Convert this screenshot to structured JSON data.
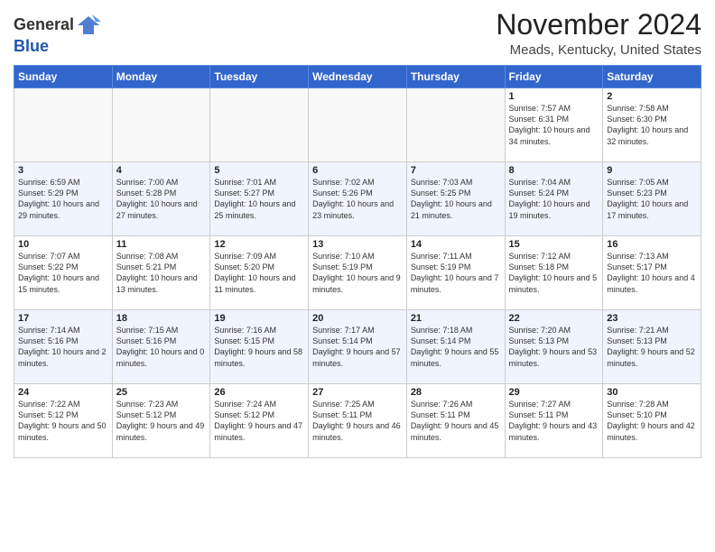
{
  "header": {
    "logo_general": "General",
    "logo_blue": "Blue",
    "month_title": "November 2024",
    "location": "Meads, Kentucky, United States"
  },
  "weekdays": [
    "Sunday",
    "Monday",
    "Tuesday",
    "Wednesday",
    "Thursday",
    "Friday",
    "Saturday"
  ],
  "weeks": [
    [
      {
        "day": "",
        "info": ""
      },
      {
        "day": "",
        "info": ""
      },
      {
        "day": "",
        "info": ""
      },
      {
        "day": "",
        "info": ""
      },
      {
        "day": "",
        "info": ""
      },
      {
        "day": "1",
        "info": "Sunrise: 7:57 AM\nSunset: 6:31 PM\nDaylight: 10 hours and 34 minutes."
      },
      {
        "day": "2",
        "info": "Sunrise: 7:58 AM\nSunset: 6:30 PM\nDaylight: 10 hours and 32 minutes."
      }
    ],
    [
      {
        "day": "3",
        "info": "Sunrise: 6:59 AM\nSunset: 5:29 PM\nDaylight: 10 hours and 29 minutes."
      },
      {
        "day": "4",
        "info": "Sunrise: 7:00 AM\nSunset: 5:28 PM\nDaylight: 10 hours and 27 minutes."
      },
      {
        "day": "5",
        "info": "Sunrise: 7:01 AM\nSunset: 5:27 PM\nDaylight: 10 hours and 25 minutes."
      },
      {
        "day": "6",
        "info": "Sunrise: 7:02 AM\nSunset: 5:26 PM\nDaylight: 10 hours and 23 minutes."
      },
      {
        "day": "7",
        "info": "Sunrise: 7:03 AM\nSunset: 5:25 PM\nDaylight: 10 hours and 21 minutes."
      },
      {
        "day": "8",
        "info": "Sunrise: 7:04 AM\nSunset: 5:24 PM\nDaylight: 10 hours and 19 minutes."
      },
      {
        "day": "9",
        "info": "Sunrise: 7:05 AM\nSunset: 5:23 PM\nDaylight: 10 hours and 17 minutes."
      }
    ],
    [
      {
        "day": "10",
        "info": "Sunrise: 7:07 AM\nSunset: 5:22 PM\nDaylight: 10 hours and 15 minutes."
      },
      {
        "day": "11",
        "info": "Sunrise: 7:08 AM\nSunset: 5:21 PM\nDaylight: 10 hours and 13 minutes."
      },
      {
        "day": "12",
        "info": "Sunrise: 7:09 AM\nSunset: 5:20 PM\nDaylight: 10 hours and 11 minutes."
      },
      {
        "day": "13",
        "info": "Sunrise: 7:10 AM\nSunset: 5:19 PM\nDaylight: 10 hours and 9 minutes."
      },
      {
        "day": "14",
        "info": "Sunrise: 7:11 AM\nSunset: 5:19 PM\nDaylight: 10 hours and 7 minutes."
      },
      {
        "day": "15",
        "info": "Sunrise: 7:12 AM\nSunset: 5:18 PM\nDaylight: 10 hours and 5 minutes."
      },
      {
        "day": "16",
        "info": "Sunrise: 7:13 AM\nSunset: 5:17 PM\nDaylight: 10 hours and 4 minutes."
      }
    ],
    [
      {
        "day": "17",
        "info": "Sunrise: 7:14 AM\nSunset: 5:16 PM\nDaylight: 10 hours and 2 minutes."
      },
      {
        "day": "18",
        "info": "Sunrise: 7:15 AM\nSunset: 5:16 PM\nDaylight: 10 hours and 0 minutes."
      },
      {
        "day": "19",
        "info": "Sunrise: 7:16 AM\nSunset: 5:15 PM\nDaylight: 9 hours and 58 minutes."
      },
      {
        "day": "20",
        "info": "Sunrise: 7:17 AM\nSunset: 5:14 PM\nDaylight: 9 hours and 57 minutes."
      },
      {
        "day": "21",
        "info": "Sunrise: 7:18 AM\nSunset: 5:14 PM\nDaylight: 9 hours and 55 minutes."
      },
      {
        "day": "22",
        "info": "Sunrise: 7:20 AM\nSunset: 5:13 PM\nDaylight: 9 hours and 53 minutes."
      },
      {
        "day": "23",
        "info": "Sunrise: 7:21 AM\nSunset: 5:13 PM\nDaylight: 9 hours and 52 minutes."
      }
    ],
    [
      {
        "day": "24",
        "info": "Sunrise: 7:22 AM\nSunset: 5:12 PM\nDaylight: 9 hours and 50 minutes."
      },
      {
        "day": "25",
        "info": "Sunrise: 7:23 AM\nSunset: 5:12 PM\nDaylight: 9 hours and 49 minutes."
      },
      {
        "day": "26",
        "info": "Sunrise: 7:24 AM\nSunset: 5:12 PM\nDaylight: 9 hours and 47 minutes."
      },
      {
        "day": "27",
        "info": "Sunrise: 7:25 AM\nSunset: 5:11 PM\nDaylight: 9 hours and 46 minutes."
      },
      {
        "day": "28",
        "info": "Sunrise: 7:26 AM\nSunset: 5:11 PM\nDaylight: 9 hours and 45 minutes."
      },
      {
        "day": "29",
        "info": "Sunrise: 7:27 AM\nSunset: 5:11 PM\nDaylight: 9 hours and 43 minutes."
      },
      {
        "day": "30",
        "info": "Sunrise: 7:28 AM\nSunset: 5:10 PM\nDaylight: 9 hours and 42 minutes."
      }
    ]
  ]
}
